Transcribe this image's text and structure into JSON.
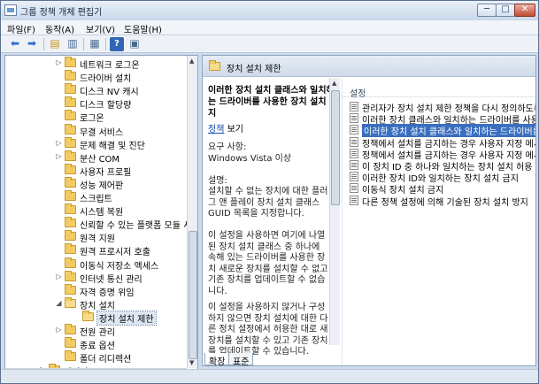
{
  "window": {
    "title": "그룹 정책 개체 편집기",
    "minimize": "─",
    "maximize": "□",
    "close": "✕"
  },
  "menu": [
    "파일(F)",
    "동작(A)",
    "보기(V)",
    "도움말(H)"
  ],
  "toolbar": {
    "icons": [
      "back-arrow-icon",
      "forward-arrow-icon",
      "up-folder-icon",
      "show-hide-tree-icon",
      "export-list-icon",
      "help-icon",
      "properties-icon"
    ]
  },
  "tree": {
    "items": [
      {
        "label": "네트워크 로그온",
        "expander": "▷",
        "level": 0
      },
      {
        "label": "드라이버 설치",
        "expander": "",
        "level": 0
      },
      {
        "label": "디스크 NV 캐시",
        "expander": "",
        "level": 0
      },
      {
        "label": "디스크 할당량",
        "expander": "",
        "level": 0
      },
      {
        "label": "로그온",
        "expander": "",
        "level": 0
      },
      {
        "label": "무결 서비스",
        "expander": "",
        "level": 0
      },
      {
        "label": "문제 해결 및 진단",
        "expander": "▷",
        "level": 0
      },
      {
        "label": "분산 COM",
        "expander": "▷",
        "level": 0
      },
      {
        "label": "사용자 프로필",
        "expander": "",
        "level": 0
      },
      {
        "label": "성능 제어판",
        "expander": "",
        "level": 0
      },
      {
        "label": "스크립트",
        "expander": "",
        "level": 0
      },
      {
        "label": "시스템 복원",
        "expander": "",
        "level": 0
      },
      {
        "label": "신뢰할 수 있는 플랫폼 모듈 서",
        "expander": "",
        "level": 0
      },
      {
        "label": "원격 지원",
        "expander": "",
        "level": 0
      },
      {
        "label": "원격 프로시저 호출",
        "expander": "",
        "level": 0
      },
      {
        "label": "이동식 저장소 액세스",
        "expander": "",
        "level": 0
      },
      {
        "label": "인터넷 통신 관리",
        "expander": "▷",
        "level": 0
      },
      {
        "label": "자격 증명 위임",
        "expander": "",
        "level": 0
      },
      {
        "label": "장치 설치",
        "expander": "◢",
        "level": 0,
        "open": true
      },
      {
        "label": "장치 설치 제한",
        "expander": "",
        "level": 1,
        "selected": true
      },
      {
        "label": "전원 관리",
        "expander": "▷",
        "level": 0
      },
      {
        "label": "종료 옵션",
        "expander": "",
        "level": 0
      },
      {
        "label": "폴더 리디렉션",
        "expander": "",
        "level": 0
      },
      {
        "label": "제어판",
        "expander": "▷",
        "level": -1
      },
      {
        "label": "바탕 화면",
        "expander": "▷",
        "level": -1
      }
    ]
  },
  "right": {
    "header_title": "장치 설치 제한",
    "description": {
      "title": "이러한 장치 설치 클래스와 일치하는 드라이버를 사용한 장치 설치 금지",
      "edit_link": "정책",
      "edit_suffix": " 보기",
      "requirements_label": "요구 사항:",
      "requirements_value": "Windows Vista 이상",
      "description_label": "설명:",
      "description_text": "설치할 수 없는 장치에 대한 플러그 앤 플레이 장치 설치 클래스 GUID 목록을 지정합니다.",
      "paragraph2": "이 설정을 사용하면 여기에 나열된 장치 설치 클래스 중 하나에 속해 있는 드라이버를 사용한 장치 새로운 장치를 설치할 수 없고 기존 장치를 업데이트할 수 없습니다.",
      "paragraph3": "이 설정을 사용하지 않거나 구성하지 않으면 장치 설치에 대한 다른 정치 설정에서 허용한 대로 새 장치를 설치할 수 있고 기존 장치를 업데이트할 수 있습니다."
    },
    "list_header": "설정",
    "policies": [
      {
        "label": "관리자가 장치 설치 제한 정책을 다시 정의하도록 허용",
        "selected": false
      },
      {
        "label": "이러한 장치 클래스와 일치하는 드라이버를 사용한",
        "selected": false
      },
      {
        "label": "이러한 장치 설치 클래스와 일치하는 드라이버를 사",
        "selected": true
      },
      {
        "label": "정책에서 설치를 금지하는 경우 사용자 지정 메시지",
        "selected": false
      },
      {
        "label": "정책에서 설치를 금지하는 경우 사용자 지정 메시지",
        "selected": false
      },
      {
        "label": "이 장치 ID 중 하나와 일치하는 장치 설치 허용",
        "selected": false
      },
      {
        "label": "이러한 장치 ID와 일치하는 장치 설치 금지",
        "selected": false
      },
      {
        "label": "이동식 장치 설치 금지",
        "selected": false
      },
      {
        "label": "다른 정책 설정에 의해 기술된 장치 설치 방지",
        "selected": false
      }
    ]
  },
  "tabs": [
    {
      "label": "확장",
      "active": true
    },
    {
      "label": "표준",
      "active": false
    }
  ]
}
